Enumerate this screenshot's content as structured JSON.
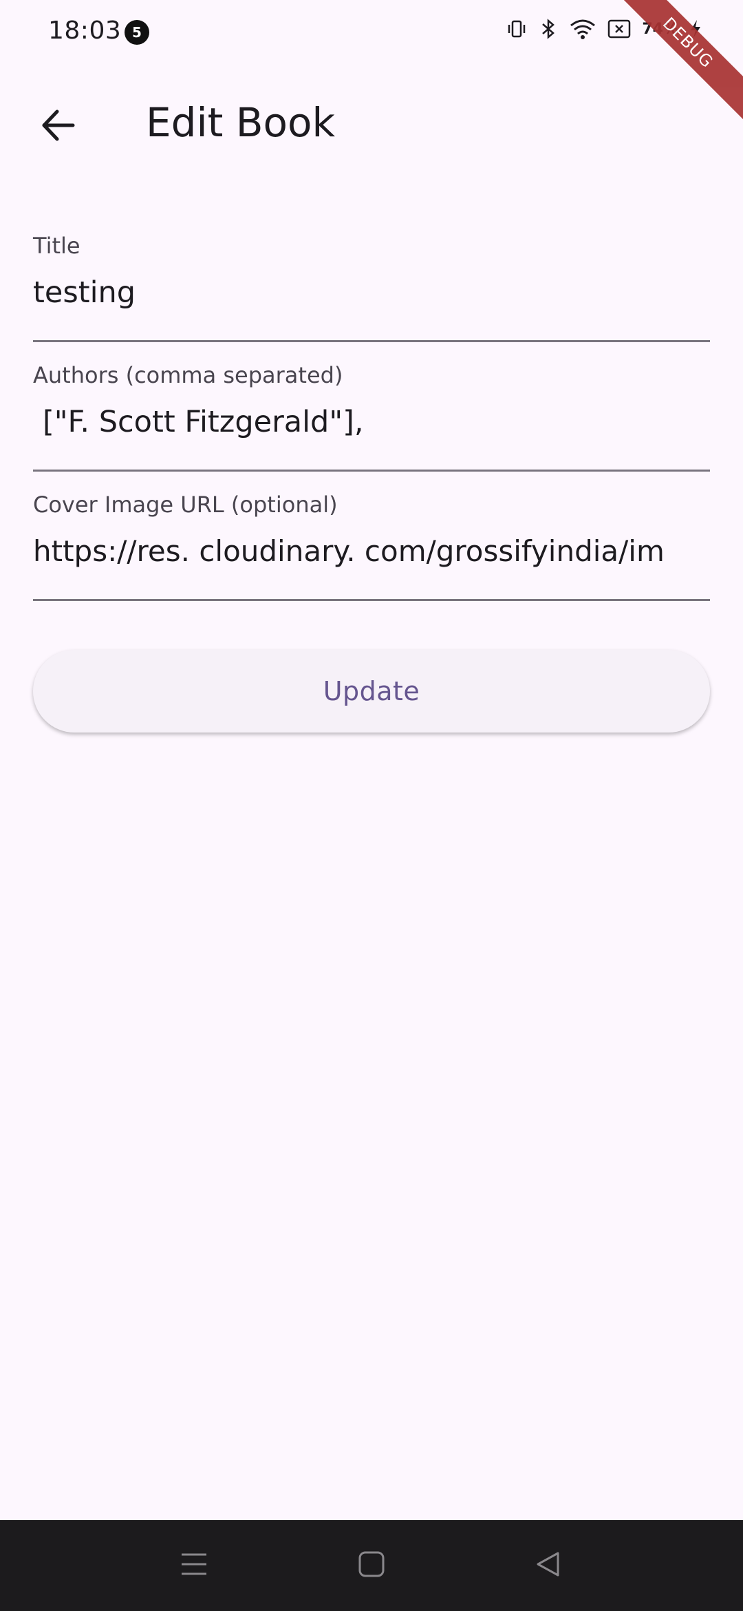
{
  "status_bar": {
    "time": "18:03",
    "notification_count": "5",
    "battery": "74%",
    "icons": [
      "vibrate-icon",
      "bluetooth-icon",
      "wifi-icon",
      "no-sim-icon",
      "battery-icon",
      "charging-icon"
    ]
  },
  "debug_ribbon": "DEBUG",
  "app_bar": {
    "title": "Edit Book",
    "back_icon": "arrow-back-icon"
  },
  "form": {
    "title": {
      "label": "Title",
      "value": "testing"
    },
    "authors": {
      "label": "Authors (comma separated)",
      "value": "[\"F.  Scott Fitzgerald\"],"
    },
    "cover": {
      "label": "Cover Image URL (optional)",
      "value": "https://res. cloudinary. com/grossifyindia/im"
    }
  },
  "actions": {
    "update_label": "Update"
  },
  "nav_bar": {
    "items": [
      "menu-icon",
      "home-icon",
      "back-triangle-icon"
    ]
  },
  "colors": {
    "background": "#fdf7fe",
    "accent": "#65558f",
    "underline": "#79747e",
    "nav_bar": "#1c1b1d",
    "debug": "#a83232"
  }
}
